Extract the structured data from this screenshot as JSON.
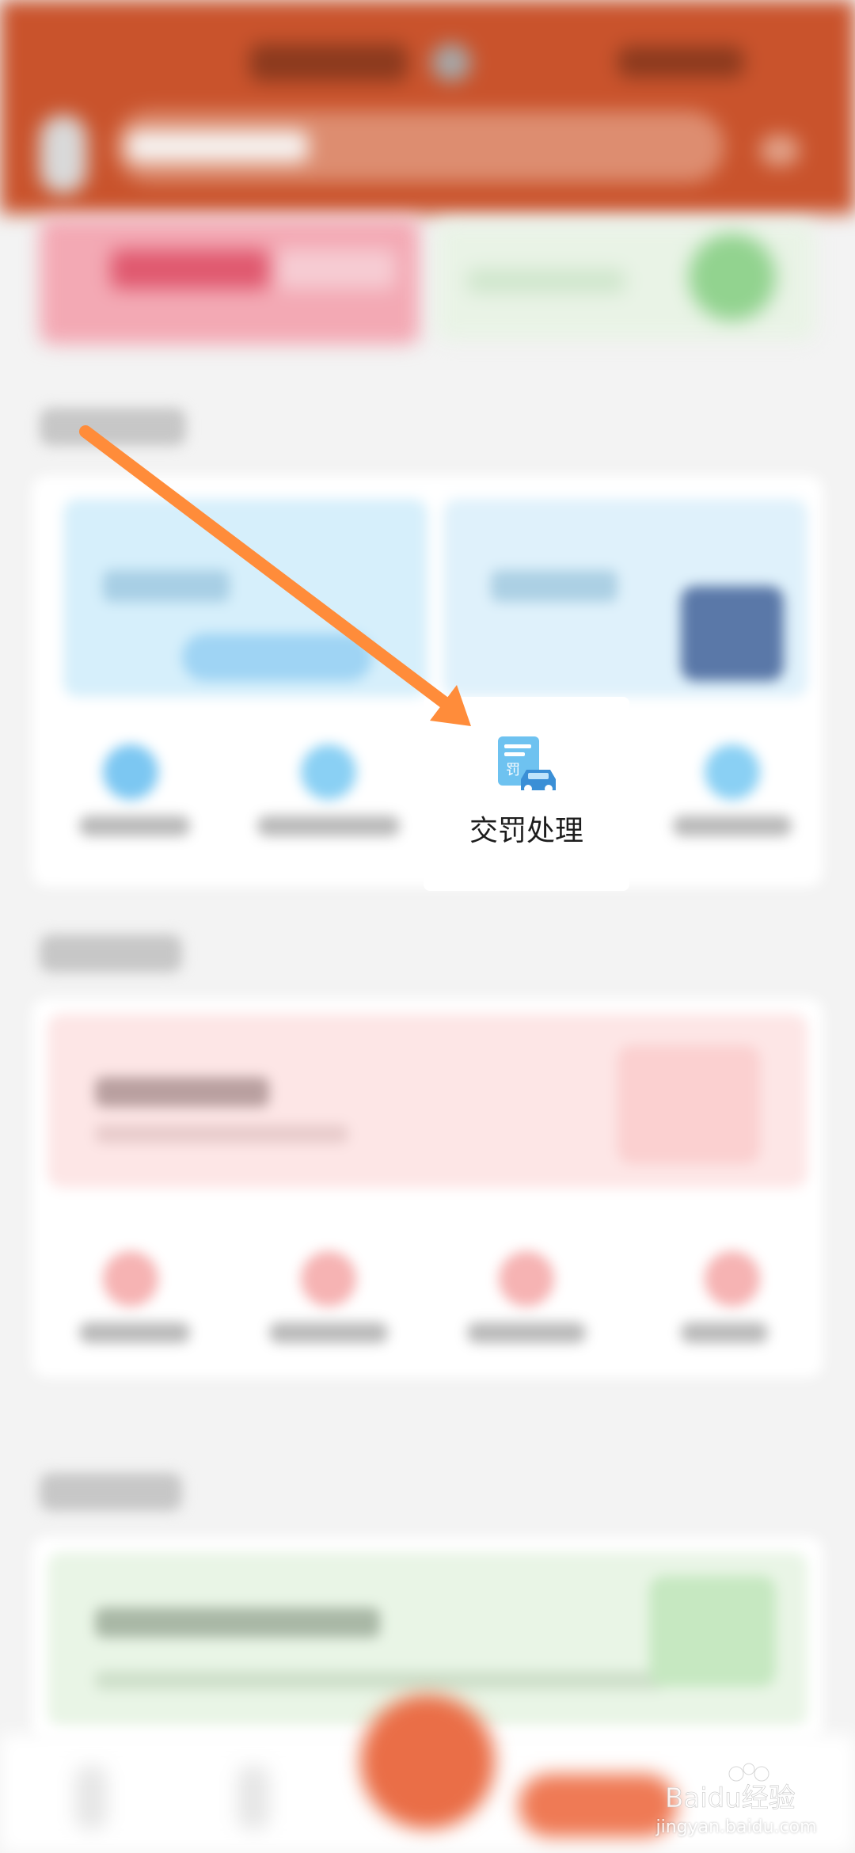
{
  "focused_service": {
    "label": "交罚处理",
    "icon": "fine-ticket-car-icon"
  },
  "annotation": {
    "type": "arrow",
    "color": "#ff8c3a"
  },
  "watermark": {
    "brand": "Baidu经验",
    "url": "jingyan.baidu.com"
  },
  "colors": {
    "header": "#c9532c",
    "accent_orange": "#ff8c3a",
    "icon_blue": "#4fb3ef"
  }
}
